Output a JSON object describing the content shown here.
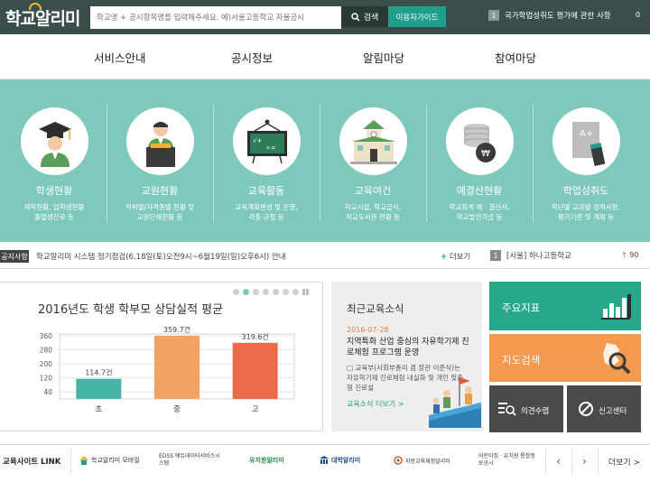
{
  "header": {
    "logo": "학교알리미",
    "search_placeholder": "학교명 + 공시항목명를 입력해주세요. 예)서울고등학교 자율공시",
    "search_label": "검색",
    "guide_label": "이용자가이드",
    "notice_num": "1",
    "notice_text": "국가학업성취도 평가에 관한 사항",
    "notice_count": "0"
  },
  "nav": [
    "서비스안내",
    "공시정보",
    "알림마당",
    "참여마당"
  ],
  "categories": [
    {
      "title": "학생현황",
      "desc1": "재학현황, 입학생현황",
      "desc2": "졸업생진로 등"
    },
    {
      "title": "교원현황",
      "desc1": "직위별/자격종별 현황 및",
      "desc2": "교원단체현황 등"
    },
    {
      "title": "교육활동",
      "desc1": "교육계획편성 및 운영,",
      "desc2": "각종 규정 등"
    },
    {
      "title": "교육여건",
      "desc1": "학교시설, 학교급식,",
      "desc2": "학교도서관 현황 등"
    },
    {
      "title": "예결산현황",
      "desc1": "학교회계 예 · 결산서,",
      "desc2": "학교발전기금 등"
    },
    {
      "title": "학업성취도",
      "desc1": "학년별 교과별 성적사항,",
      "desc2": "평가기준 및 계획 등"
    }
  ],
  "ticker": {
    "tag": "공지사항",
    "text": "학교알리미 시스템 정기점검(6.18일(토)오전9시~6월19일(일)오후6시) 안내",
    "more_plus": "+",
    "more": "더보기",
    "rank_num": "1",
    "rank_text": "[서울] 하나고등학교",
    "up_arrow": "↑",
    "up_value": "90"
  },
  "chart_data": {
    "type": "bar",
    "title": "2016년도 학생 학부모 상담실적 평균",
    "categories": [
      "초",
      "중",
      "고"
    ],
    "values": [
      114.7,
      359.7,
      319.6
    ],
    "value_labels": [
      "114.7건",
      "359.7건",
      "319.6건"
    ],
    "colors": [
      "#45b4a6",
      "#f3a261",
      "#ea6a4a"
    ],
    "yticks": [
      40,
      120,
      200,
      280,
      360
    ],
    "ylim": [
      0,
      370
    ],
    "grid": true
  },
  "news": {
    "title": "최근교육소식",
    "date": "2016-07-28",
    "headline": "지역특화 산업 중심의 자유학기제 진로체험 프로그램 운영",
    "summary": "□ 교육부(사회부총리 겸 장관 이준식)는 자유학기제 진로체험 내실화 및 개인 맞춤형 진로설",
    "more": "교육소식 더보기 >"
  },
  "tiles": {
    "main_indicators": "주요지표",
    "map_search": "지도검색",
    "opinion": "의견수렴",
    "report": "신고센터"
  },
  "footer": {
    "label": "교육사이트 LINK",
    "links": [
      "학교알리미 모바일",
      "EDSS 에듀데이터서비스시스템",
      "유치원알리미",
      "대학알리미",
      "지방교육재정알리미",
      "어린이집 · 유치원 통합정보공시"
    ],
    "prev": "‹",
    "next": "›",
    "more": "더보기 >"
  },
  "colors": {
    "accent": "#1f9e89",
    "hero": "#7ec9bb",
    "topbar": "#3a4f4c"
  }
}
